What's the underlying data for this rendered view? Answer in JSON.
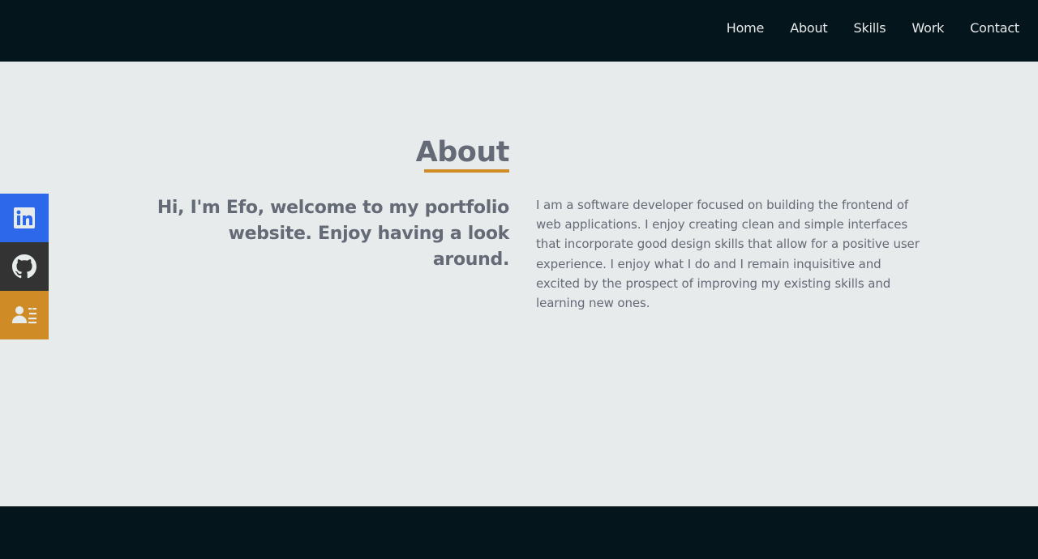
{
  "nav": {
    "items": [
      {
        "label": "Home"
      },
      {
        "label": "About"
      },
      {
        "label": "Skills"
      },
      {
        "label": "Work"
      },
      {
        "label": "Contact"
      }
    ]
  },
  "about": {
    "title": "About",
    "intro": "Hi, I'm Efo, welcome to my portfolio website. Enjoy having a look around.",
    "bio": "I am a software developer focused on building the frontend of web applications. I enjoy creating clean and simple interfaces that incorporate good design skills that allow for a positive user experience. I enjoy what I do and I remain inquisitive and excited by the prospect of improving my existing skills and learning new ones."
  },
  "social": {
    "links": [
      {
        "icon": "linkedin-icon",
        "color": "#2d68ea"
      },
      {
        "icon": "github-icon",
        "color": "#333333"
      },
      {
        "icon": "resume-icon",
        "color": "#cf8b25"
      }
    ]
  },
  "colors": {
    "header_bg": "#05151c",
    "page_bg": "#e7ebec",
    "accent": "#cf8b25",
    "text": "#656a77"
  }
}
